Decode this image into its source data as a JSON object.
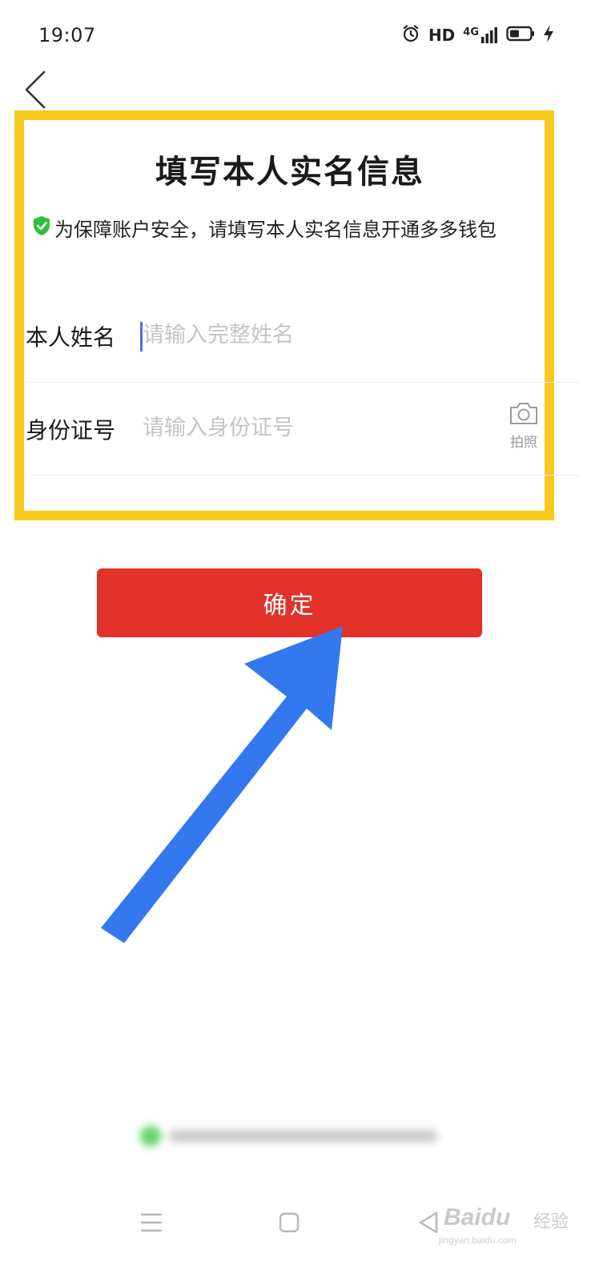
{
  "status_bar": {
    "time": "19:07",
    "network_label": "HD",
    "signal_label": "4G",
    "icons": [
      "alarm-icon",
      "signal-icon",
      "battery-icon",
      "charging-icon"
    ]
  },
  "header": {
    "back_icon": "chevron-left-icon",
    "title": "填写本人实名信息"
  },
  "notice": {
    "icon": "shield-check-icon",
    "text": "为保障账户安全，请填写本人实名信息开通多多钱包"
  },
  "form": {
    "name_field": {
      "label": "本人姓名",
      "placeholder": "请输入完整姓名",
      "value": ""
    },
    "id_field": {
      "label": "身份证号",
      "placeholder": "请输入身份证号",
      "value": "",
      "photo_label": "拍照",
      "photo_icon": "camera-icon"
    }
  },
  "confirm_button": {
    "label": "确定"
  },
  "nav": {
    "icons": [
      "menu-icon",
      "home-icon",
      "back-triangle-icon"
    ]
  },
  "watermark": {
    "brand": "Baidu",
    "sub": "经验",
    "url": "jingyan.baidu.com"
  },
  "colors": {
    "highlight": "#f8c81c",
    "confirm": "#e2322a",
    "arrow": "#3478f0",
    "shield": "#2fbf3b",
    "caret": "#4a6fe8"
  }
}
